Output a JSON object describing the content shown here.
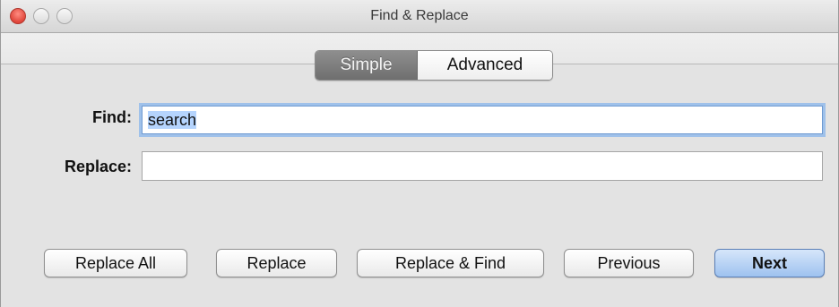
{
  "window": {
    "title": "Find & Replace"
  },
  "mode_tabs": {
    "simple": "Simple",
    "advanced": "Advanced",
    "selected": "Simple"
  },
  "find": {
    "label": "Find:",
    "value": "search"
  },
  "replace": {
    "label": "Replace:",
    "value": ""
  },
  "buttons": {
    "replace_all": "Replace All",
    "replace": "Replace",
    "replace_and_find": "Replace & Find",
    "previous": "Previous",
    "next": "Next"
  }
}
